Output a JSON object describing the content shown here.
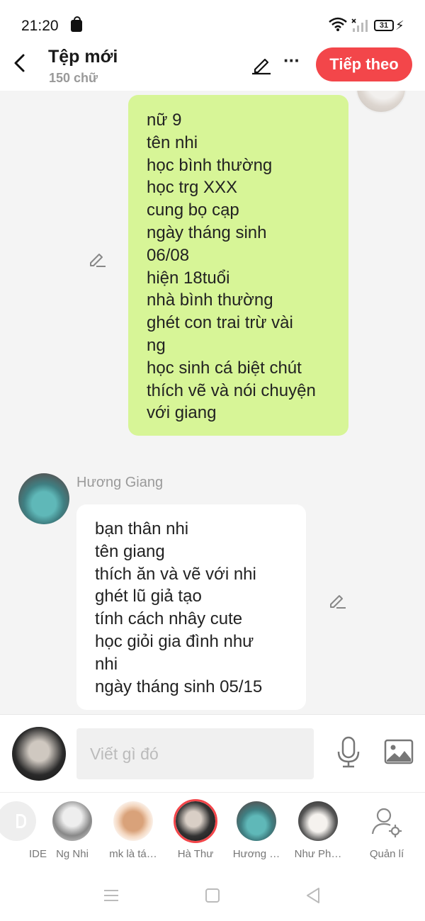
{
  "status": {
    "time": "21:20",
    "battery": "31"
  },
  "header": {
    "title": "Tệp mới",
    "word_count": "150 chữ",
    "next_label": "Tiếp theo"
  },
  "messages": {
    "first": {
      "lines": [
        "nữ 9",
        "tên nhi",
        "học bình thường",
        "học trg XXX",
        "cung bọ cạp",
        "ngày tháng sinh",
        "06/08",
        "hiện 18tuổi",
        "nhà bình thường",
        "ghét con trai trừ vài",
        "ng",
        "học sinh cá biệt chút",
        "thích vẽ và nói chuyện",
        "với giang"
      ]
    },
    "second": {
      "sender": "Hương Giang",
      "lines": [
        "bạn thân nhi",
        "tên giang",
        "thích ăn và vẽ với nhi",
        "ghét lũ giả tạo",
        "tính cách nhây cute",
        "học giỏi gia đình như",
        "nhi",
        "ngày tháng sinh 05/15"
      ]
    }
  },
  "input": {
    "placeholder": "Viết gì đó"
  },
  "characters": [
    {
      "label": "IDE"
    },
    {
      "label": "Ng Nhi"
    },
    {
      "label": "mk là tá…"
    },
    {
      "label": "Hà Thư"
    },
    {
      "label": "Hương …"
    },
    {
      "label": "Như Ph…"
    },
    {
      "label": "Quản lí"
    }
  ],
  "colors": {
    "accent": "#f3464a",
    "bubble_self": "#d7f597"
  }
}
